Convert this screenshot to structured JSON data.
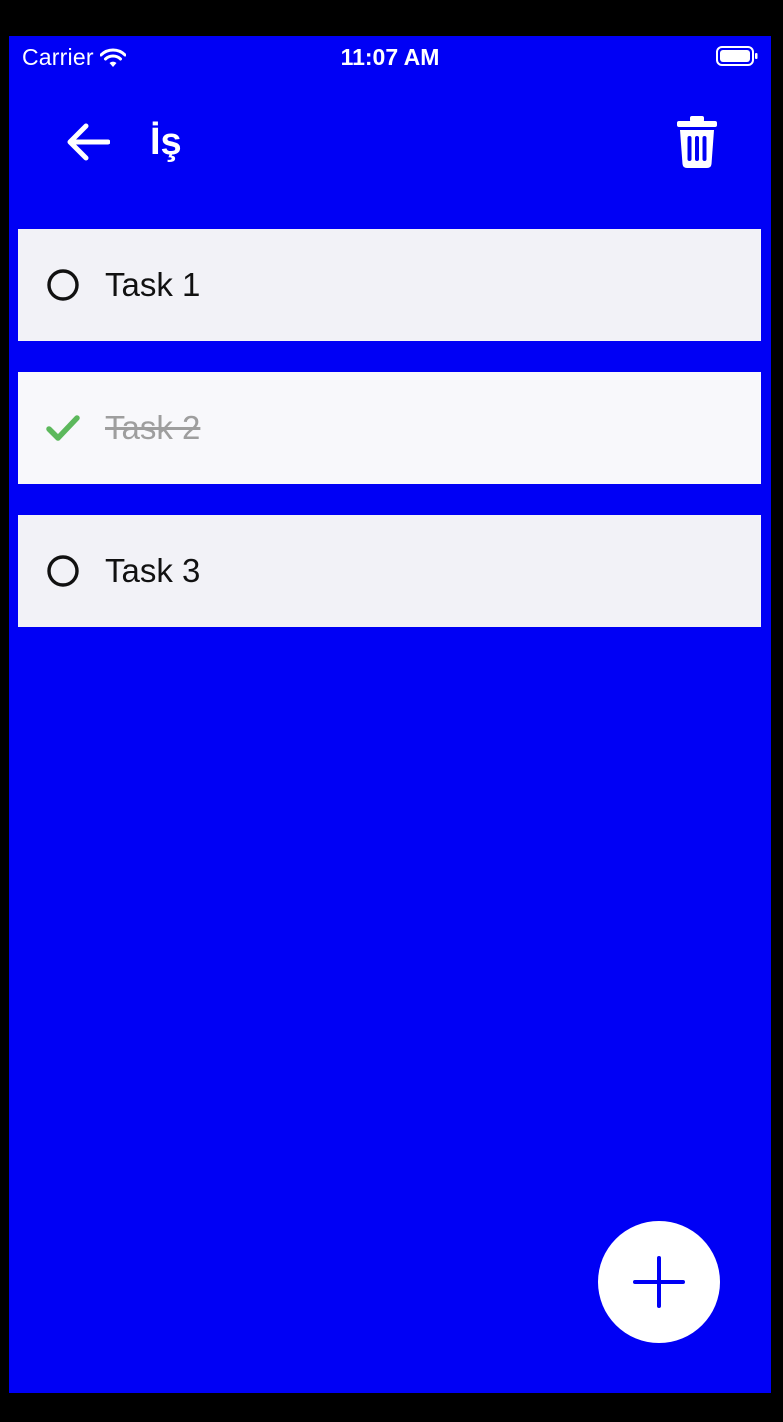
{
  "status_bar": {
    "carrier": "Carrier",
    "time": "11:07 AM"
  },
  "header": {
    "title": "İş",
    "back_icon": "arrow-left-icon",
    "delete_icon": "trash-icon"
  },
  "tasks": [
    {
      "label": "Task 1",
      "completed": false
    },
    {
      "label": "Task 2",
      "completed": true
    },
    {
      "label": "Task 3",
      "completed": false
    }
  ],
  "fab": {
    "icon": "plus-icon"
  },
  "colors": {
    "background": "#0000F5",
    "row": "#F2F2F7",
    "check": "#5CB85C",
    "done_text": "#9E9E9E"
  }
}
